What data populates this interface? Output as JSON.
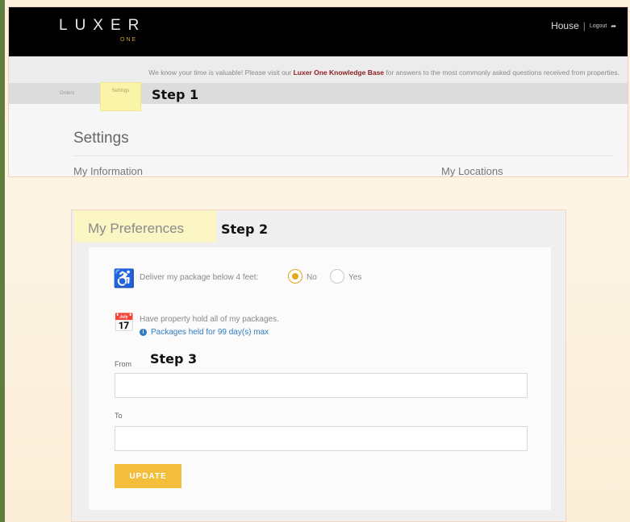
{
  "header": {
    "logo_text": "LUXER",
    "logo_subtext": "ONE",
    "property_name": "House",
    "separator": "|",
    "logout_label": "Logout",
    "logout_icon": "logout-arrow-icon"
  },
  "notice": {
    "prefix": "We know your time is valuable! Please visit our ",
    "link_text": "Luxer One Knowledge Base",
    "suffix": " for answers to the most commonly asked questions received from properties."
  },
  "tabs": {
    "orders_label": "Orders",
    "settings_label": "Settings"
  },
  "annotations": {
    "step1": "Step 1",
    "step2": "Step 2",
    "step3": "Step 3"
  },
  "settings": {
    "title": "Settings",
    "my_information": "My Information",
    "my_locations": "My Locations"
  },
  "preferences": {
    "title": "My Preferences",
    "deliver_label": "Deliver my package below 4 feet:",
    "deliver_icon": "wheelchair-icon",
    "option_no": "No",
    "option_yes": "Yes",
    "selected_option": "No",
    "hold_label": "Have property hold all of my packages.",
    "hold_icon": "calendar-icon",
    "held_info": "Packages held for 99 day(s) max",
    "info_icon": "info-icon",
    "from_label": "From",
    "from_value": "",
    "to_label": "To",
    "to_value": "",
    "update_label": "UPDATE"
  },
  "colors": {
    "accent": "#f2be3c",
    "header_bg": "#000000",
    "link_red": "#8e2020",
    "info_blue": "#2e7bbf",
    "highlight": "#faf4a8",
    "left_rail": "#5e7d3e"
  }
}
